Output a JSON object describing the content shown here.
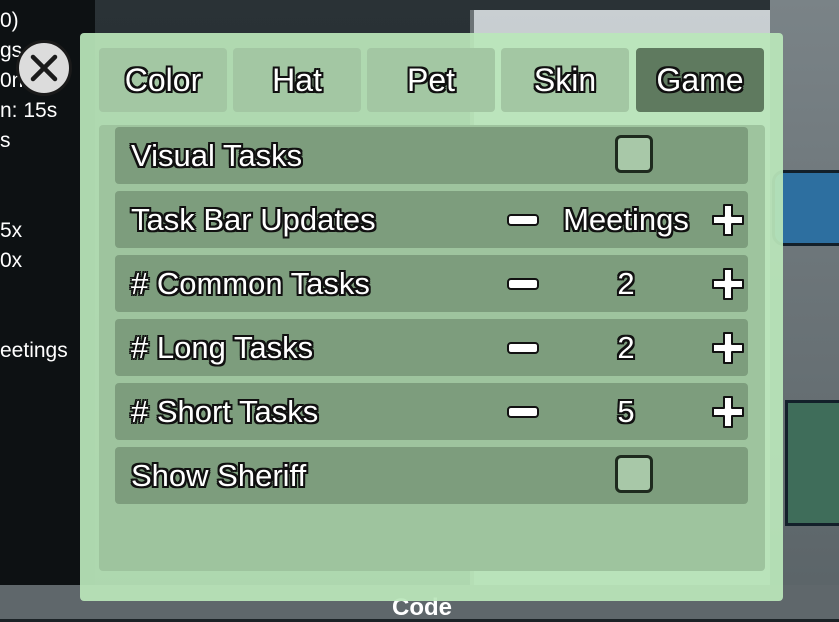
{
  "left_stats": [
    "0)",
    "gs",
    "0n",
    "n: 15s",
    "s",
    "",
    "",
    "5x",
    "0x",
    "",
    "",
    "eetings"
  ],
  "footer": {
    "code_label": "Code"
  },
  "tabs": [
    {
      "label": "Color",
      "active": false
    },
    {
      "label": "Hat",
      "active": false
    },
    {
      "label": "Pet",
      "active": false
    },
    {
      "label": "Skin",
      "active": false
    },
    {
      "label": "Game",
      "active": true
    }
  ],
  "settings": [
    {
      "label": "Visual Tasks",
      "type": "checkbox",
      "checked": false
    },
    {
      "label": "Task Bar Updates",
      "type": "stepper",
      "value": "Meetings"
    },
    {
      "label": "# Common Tasks",
      "type": "stepper",
      "value": "2"
    },
    {
      "label": "# Long Tasks",
      "type": "stepper",
      "value": "2"
    },
    {
      "label": "# Short Tasks",
      "type": "stepper",
      "value": "5"
    },
    {
      "label": "Show Sheriff",
      "type": "checkbox",
      "checked": false
    }
  ],
  "icons": {
    "close": "close-icon",
    "minus": "minus-icon",
    "plus": "plus-icon"
  },
  "colors": {
    "panel": "#bae6ba",
    "row": "#7d9d7d",
    "active_tab": "#5f7a5f",
    "tab": "#a3c7a3"
  }
}
